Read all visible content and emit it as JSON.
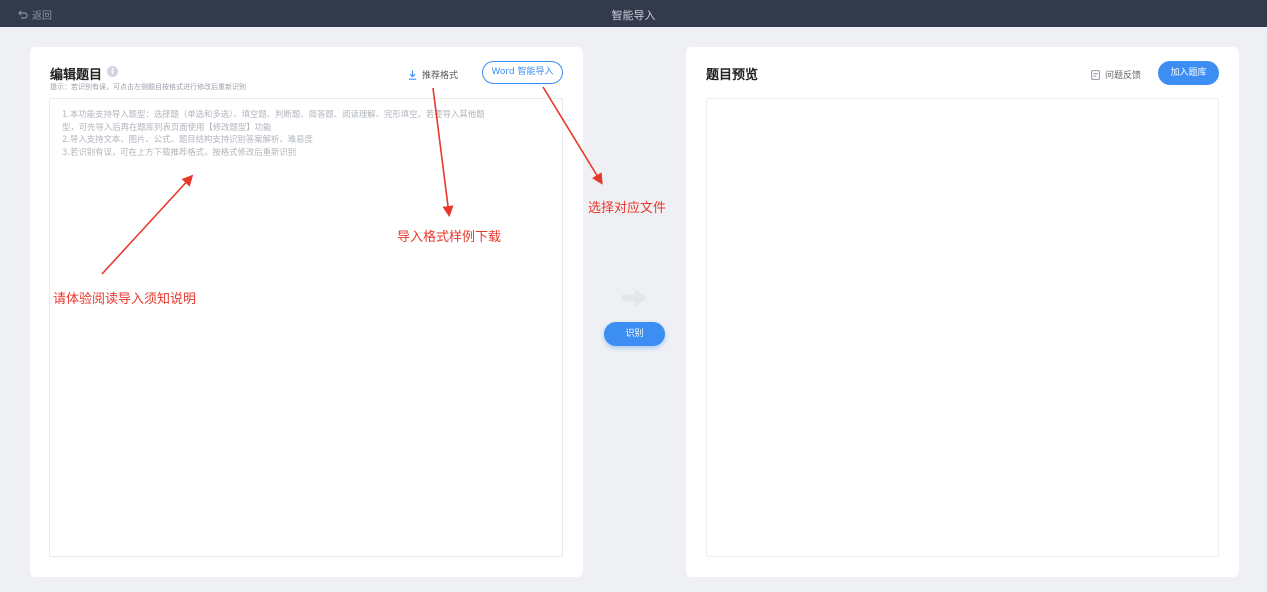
{
  "topbar": {
    "back_label": "返回",
    "title": "智能导入"
  },
  "editor_panel": {
    "title": "编辑题目",
    "hint": "提示：若识别有误，可点击左侧题目按格式进行修改后重新识别",
    "recommend_label": "推荐格式",
    "word_import_label": "Word 智能导入",
    "instructions": [
      "1.本功能支持导入题型：选择题（单选和多选）、填空题、判断题、简答题、阅读理解、完形填空。若要导入其他题",
      "型，可先导入后再在题库列表页面使用【修改题型】功能",
      "2.导入支持文本、图片、公式。题目结构支持识别答案解析、难易度",
      "3.若识别有误，可在上方下载推荐格式，按格式修改后重新识别"
    ]
  },
  "preview_panel": {
    "title": "题目预览",
    "feedback_label": "问题反馈",
    "add_label": "加入题库"
  },
  "center": {
    "recognize_label": "识别"
  },
  "annotations": {
    "read_instructions": "请体验阅读导入须知说明",
    "format_download": "导入格式样例下载",
    "choose_file": "选择对应文件"
  },
  "colors": {
    "accent": "#3d8ef3",
    "annotation": "#e8372c",
    "topbar": "#323a4b"
  }
}
